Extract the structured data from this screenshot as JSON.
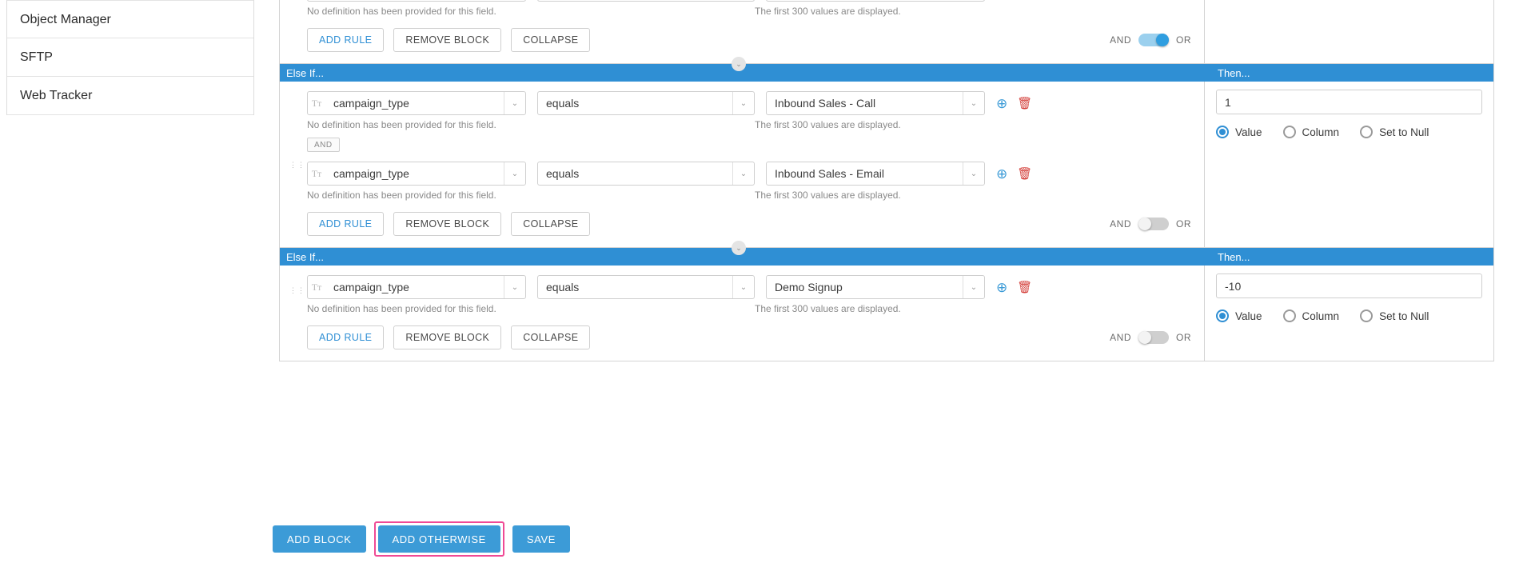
{
  "sidebar": {
    "items": [
      {
        "label": "Object Manager"
      },
      {
        "label": "SFTP"
      },
      {
        "label": "Web Tracker"
      }
    ]
  },
  "labels": {
    "field_hint": "No definition has been provided for this field.",
    "values_hint": "The first 300 values are displayed.",
    "add_rule": "ADD RULE",
    "remove_block": "REMOVE BLOCK",
    "collapse": "COLLAPSE",
    "and": "AND",
    "or": "OR",
    "and_chip": "AND",
    "else_if": "Else If...",
    "then": "Then...",
    "value": "Value",
    "column": "Column",
    "set_to_null": "Set to Null",
    "tt_icon": "Tт",
    "plus_icon": "⊕",
    "trash_icon": "🗑",
    "caret_icon": "⌄",
    "chevron_icon": "⌄"
  },
  "blocks": [
    {
      "id": "block-top-partial",
      "header_left": "",
      "header_right": "",
      "rules": [],
      "toggle_on": true,
      "show_header": false,
      "partial": true
    },
    {
      "id": "block-2",
      "header_left": "Else If...",
      "header_right": "Then...",
      "toggle_on": false,
      "rules": [
        {
          "field": "campaign_type",
          "operator": "equals",
          "value": "Inbound Sales - Call"
        },
        {
          "field": "campaign_type",
          "operator": "equals",
          "value": "Inbound Sales - Email"
        }
      ],
      "then": {
        "value": "1",
        "selected_mode": "Value"
      }
    },
    {
      "id": "block-3",
      "header_left": "Else If...",
      "header_right": "Then...",
      "toggle_on": false,
      "rules": [
        {
          "field": "campaign_type",
          "operator": "equals",
          "value": "Demo Signup"
        }
      ],
      "then": {
        "value": "-10",
        "selected_mode": "Value"
      }
    }
  ],
  "bottom_bar": {
    "add_block": "ADD BLOCK",
    "add_otherwise": "ADD OTHERWISE",
    "save": "SAVE",
    "highlight_color": "#ef4a96"
  },
  "colors": {
    "header_blue": "#2f8fd4",
    "primary_blue": "#3c9bd7",
    "link_blue": "#2f8fd4",
    "trash_red": "#d43f3a",
    "highlight_pink": "#ef4a96"
  }
}
